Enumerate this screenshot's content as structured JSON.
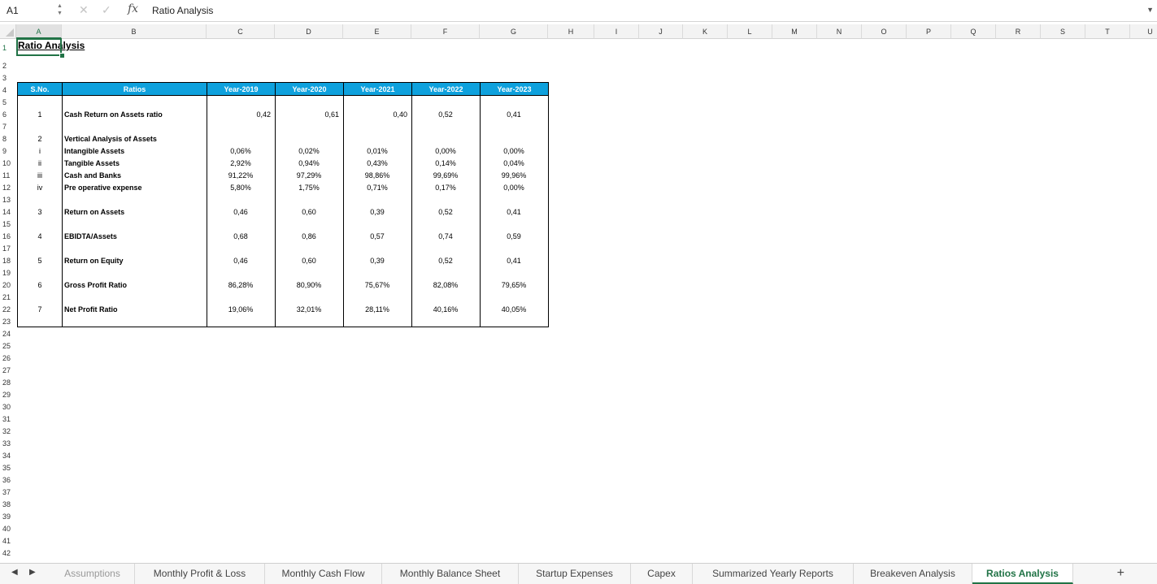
{
  "formula_bar": {
    "name_box": "A1",
    "formula": "Ratio Analysis"
  },
  "columns": [
    "A",
    "B",
    "C",
    "D",
    "E",
    "F",
    "G",
    "H",
    "I",
    "J",
    "K",
    "L",
    "M",
    "N",
    "O",
    "P",
    "Q",
    "R",
    "S",
    "T",
    "U"
  ],
  "rows": [
    "1",
    "2",
    "3",
    "4",
    "5",
    "6",
    "7",
    "8",
    "9",
    "10",
    "11",
    "12",
    "13",
    "14",
    "15",
    "16",
    "17",
    "18",
    "19",
    "20",
    "21",
    "22",
    "23",
    "24",
    "25",
    "26",
    "27",
    "28",
    "29",
    "30",
    "31",
    "32",
    "33",
    "34",
    "35",
    "36",
    "37",
    "38",
    "39",
    "40",
    "41",
    "42"
  ],
  "sheet_title": "Ratio Analysis",
  "table": {
    "headers": [
      "S.No.",
      "Ratios",
      "Year-2019",
      "Year-2020",
      "Year-2021",
      "Year-2022",
      "Year-2023"
    ],
    "rows": [
      {
        "sno": "1",
        "ratio": "Cash Return on Assets ratio",
        "values": [
          "0,42",
          "0,61",
          "0,40",
          "0,52",
          "0,41"
        ]
      },
      {
        "sno": "2",
        "ratio": "Vertical Analysis of Assets",
        "values": [
          "",
          "",
          "",
          "",
          ""
        ]
      },
      {
        "sno": "i",
        "ratio": "Intangible Assets",
        "values": [
          "0,06%",
          "0,02%",
          "0,01%",
          "0,00%",
          "0,00%"
        ]
      },
      {
        "sno": "ii",
        "ratio": "Tangible Assets",
        "values": [
          "2,92%",
          "0,94%",
          "0,43%",
          "0,14%",
          "0,04%"
        ]
      },
      {
        "sno": "iii",
        "ratio": "Cash and Banks",
        "values": [
          "91,22%",
          "97,29%",
          "98,86%",
          "99,69%",
          "99,96%"
        ]
      },
      {
        "sno": "iv",
        "ratio": "Pre operative expense",
        "values": [
          "5,80%",
          "1,75%",
          "0,71%",
          "0,17%",
          "0,00%"
        ]
      },
      {
        "sno": "3",
        "ratio": "Return on Assets",
        "values": [
          "0,46",
          "0,60",
          "0,39",
          "0,52",
          "0,41"
        ]
      },
      {
        "sno": "4",
        "ratio": "EBIDTA/Assets",
        "values": [
          "0,68",
          "0,86",
          "0,57",
          "0,74",
          "0,59"
        ]
      },
      {
        "sno": "5",
        "ratio": "Return on Equity",
        "values": [
          "0,46",
          "0,60",
          "0,39",
          "0,52",
          "0,41"
        ]
      },
      {
        "sno": "6",
        "ratio": "Gross Profit Ratio",
        "values": [
          "86,28%",
          "80,90%",
          "75,67%",
          "82,08%",
          "79,65%"
        ]
      },
      {
        "sno": "7",
        "ratio": "Net Profit Ratio",
        "values": [
          "19,06%",
          "32,01%",
          "28,11%",
          "40,16%",
          "40,05%"
        ]
      }
    ]
  },
  "tabs": [
    {
      "label": "Assumptions"
    },
    {
      "label": "Monthly Profit & Loss"
    },
    {
      "label": "Monthly Cash Flow"
    },
    {
      "label": "Monthly Balance Sheet"
    },
    {
      "label": "Startup Expenses"
    },
    {
      "label": "Capex"
    },
    {
      "label": "Summarized Yearly Reports"
    },
    {
      "label": "Breakeven Analysis"
    },
    {
      "label": "Ratios Analysis"
    }
  ],
  "active_tab": "Ratios Analysis",
  "colors": {
    "header_fill": "#0ea1dd",
    "accent": "#217346"
  }
}
